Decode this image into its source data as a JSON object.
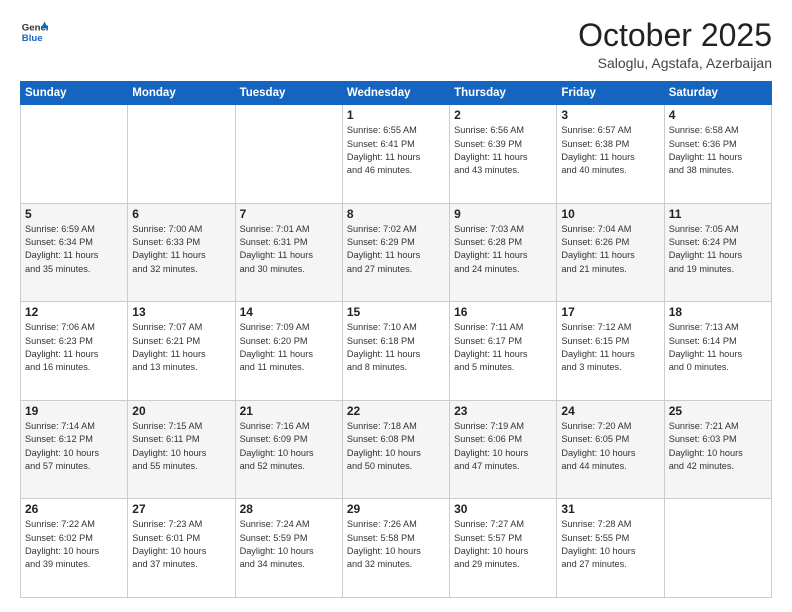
{
  "header": {
    "logo_line1": "General",
    "logo_line2": "Blue",
    "month": "October 2025",
    "location": "Saloglu, Agstafa, Azerbaijan"
  },
  "days_of_week": [
    "Sunday",
    "Monday",
    "Tuesday",
    "Wednesday",
    "Thursday",
    "Friday",
    "Saturday"
  ],
  "weeks": [
    [
      {
        "day": "",
        "info": ""
      },
      {
        "day": "",
        "info": ""
      },
      {
        "day": "",
        "info": ""
      },
      {
        "day": "1",
        "info": "Sunrise: 6:55 AM\nSunset: 6:41 PM\nDaylight: 11 hours\nand 46 minutes."
      },
      {
        "day": "2",
        "info": "Sunrise: 6:56 AM\nSunset: 6:39 PM\nDaylight: 11 hours\nand 43 minutes."
      },
      {
        "day": "3",
        "info": "Sunrise: 6:57 AM\nSunset: 6:38 PM\nDaylight: 11 hours\nand 40 minutes."
      },
      {
        "day": "4",
        "info": "Sunrise: 6:58 AM\nSunset: 6:36 PM\nDaylight: 11 hours\nand 38 minutes."
      }
    ],
    [
      {
        "day": "5",
        "info": "Sunrise: 6:59 AM\nSunset: 6:34 PM\nDaylight: 11 hours\nand 35 minutes."
      },
      {
        "day": "6",
        "info": "Sunrise: 7:00 AM\nSunset: 6:33 PM\nDaylight: 11 hours\nand 32 minutes."
      },
      {
        "day": "7",
        "info": "Sunrise: 7:01 AM\nSunset: 6:31 PM\nDaylight: 11 hours\nand 30 minutes."
      },
      {
        "day": "8",
        "info": "Sunrise: 7:02 AM\nSunset: 6:29 PM\nDaylight: 11 hours\nand 27 minutes."
      },
      {
        "day": "9",
        "info": "Sunrise: 7:03 AM\nSunset: 6:28 PM\nDaylight: 11 hours\nand 24 minutes."
      },
      {
        "day": "10",
        "info": "Sunrise: 7:04 AM\nSunset: 6:26 PM\nDaylight: 11 hours\nand 21 minutes."
      },
      {
        "day": "11",
        "info": "Sunrise: 7:05 AM\nSunset: 6:24 PM\nDaylight: 11 hours\nand 19 minutes."
      }
    ],
    [
      {
        "day": "12",
        "info": "Sunrise: 7:06 AM\nSunset: 6:23 PM\nDaylight: 11 hours\nand 16 minutes."
      },
      {
        "day": "13",
        "info": "Sunrise: 7:07 AM\nSunset: 6:21 PM\nDaylight: 11 hours\nand 13 minutes."
      },
      {
        "day": "14",
        "info": "Sunrise: 7:09 AM\nSunset: 6:20 PM\nDaylight: 11 hours\nand 11 minutes."
      },
      {
        "day": "15",
        "info": "Sunrise: 7:10 AM\nSunset: 6:18 PM\nDaylight: 11 hours\nand 8 minutes."
      },
      {
        "day": "16",
        "info": "Sunrise: 7:11 AM\nSunset: 6:17 PM\nDaylight: 11 hours\nand 5 minutes."
      },
      {
        "day": "17",
        "info": "Sunrise: 7:12 AM\nSunset: 6:15 PM\nDaylight: 11 hours\nand 3 minutes."
      },
      {
        "day": "18",
        "info": "Sunrise: 7:13 AM\nSunset: 6:14 PM\nDaylight: 11 hours\nand 0 minutes."
      }
    ],
    [
      {
        "day": "19",
        "info": "Sunrise: 7:14 AM\nSunset: 6:12 PM\nDaylight: 10 hours\nand 57 minutes."
      },
      {
        "day": "20",
        "info": "Sunrise: 7:15 AM\nSunset: 6:11 PM\nDaylight: 10 hours\nand 55 minutes."
      },
      {
        "day": "21",
        "info": "Sunrise: 7:16 AM\nSunset: 6:09 PM\nDaylight: 10 hours\nand 52 minutes."
      },
      {
        "day": "22",
        "info": "Sunrise: 7:18 AM\nSunset: 6:08 PM\nDaylight: 10 hours\nand 50 minutes."
      },
      {
        "day": "23",
        "info": "Sunrise: 7:19 AM\nSunset: 6:06 PM\nDaylight: 10 hours\nand 47 minutes."
      },
      {
        "day": "24",
        "info": "Sunrise: 7:20 AM\nSunset: 6:05 PM\nDaylight: 10 hours\nand 44 minutes."
      },
      {
        "day": "25",
        "info": "Sunrise: 7:21 AM\nSunset: 6:03 PM\nDaylight: 10 hours\nand 42 minutes."
      }
    ],
    [
      {
        "day": "26",
        "info": "Sunrise: 7:22 AM\nSunset: 6:02 PM\nDaylight: 10 hours\nand 39 minutes."
      },
      {
        "day": "27",
        "info": "Sunrise: 7:23 AM\nSunset: 6:01 PM\nDaylight: 10 hours\nand 37 minutes."
      },
      {
        "day": "28",
        "info": "Sunrise: 7:24 AM\nSunset: 5:59 PM\nDaylight: 10 hours\nand 34 minutes."
      },
      {
        "day": "29",
        "info": "Sunrise: 7:26 AM\nSunset: 5:58 PM\nDaylight: 10 hours\nand 32 minutes."
      },
      {
        "day": "30",
        "info": "Sunrise: 7:27 AM\nSunset: 5:57 PM\nDaylight: 10 hours\nand 29 minutes."
      },
      {
        "day": "31",
        "info": "Sunrise: 7:28 AM\nSunset: 5:55 PM\nDaylight: 10 hours\nand 27 minutes."
      },
      {
        "day": "",
        "info": ""
      }
    ]
  ]
}
